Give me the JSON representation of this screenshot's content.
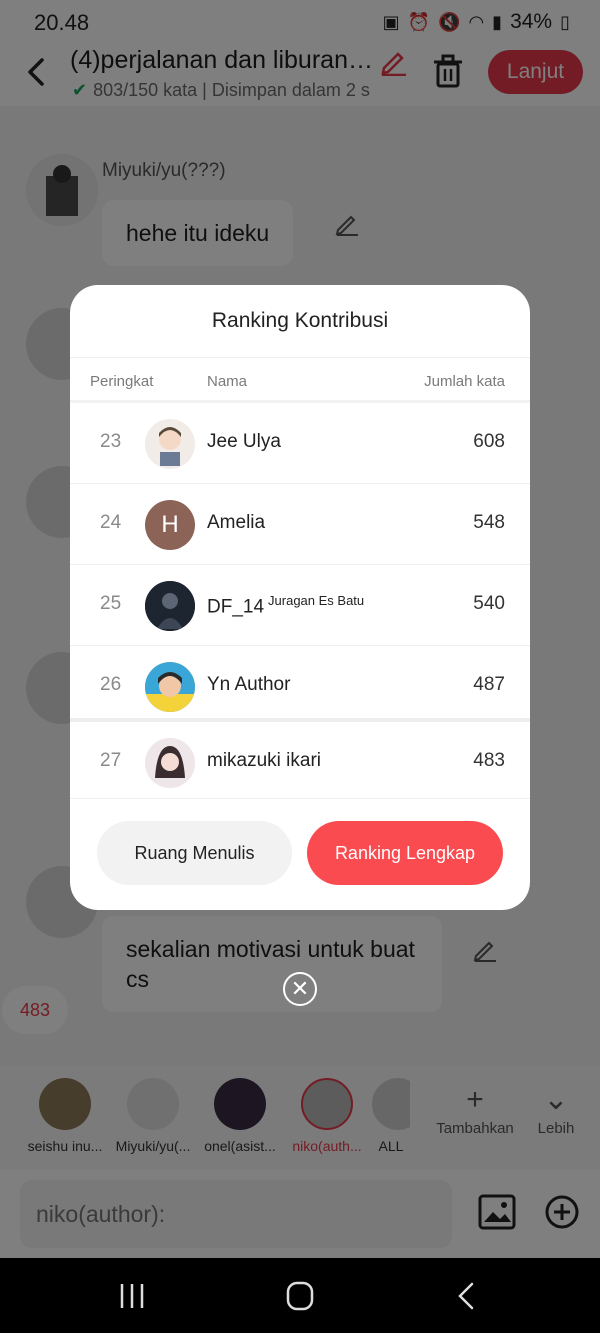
{
  "status_bar": {
    "time": "20.48",
    "battery": "34%"
  },
  "header": {
    "title": "(4)perjalanan dan liburan{...",
    "meta": "803/150 kata | Disimpan dalam 2 s",
    "next_label": "Lanjut"
  },
  "chat": {
    "messages": [
      {
        "author": "Miyuki/yu(???)",
        "text": "hehe itu ideku"
      },
      {
        "author": "",
        "text": "sekalian motivasi untuk buat cs"
      }
    ],
    "badge_count": "483"
  },
  "modal": {
    "title": "Ranking Kontribusi",
    "columns": {
      "rank": "Peringkat",
      "name": "Nama",
      "words": "Jumlah kata"
    },
    "rows": [
      {
        "rank": "23",
        "name": "Jee Ulya",
        "tag": "",
        "words": "608"
      },
      {
        "rank": "24",
        "name": "Amelia",
        "tag": "",
        "words": "548",
        "avatar_letter": "H"
      },
      {
        "rank": "25",
        "name": "DF_14",
        "tag": "Juragan Es Batu",
        "words": "540"
      },
      {
        "rank": "26",
        "name": "Yn Author",
        "tag": "",
        "words": "487"
      },
      {
        "rank": "27",
        "name": "mikazuki ikari",
        "tag": "",
        "words": "483"
      }
    ],
    "btn_room": "Ruang Menulis",
    "btn_full": "Ranking Lengkap"
  },
  "characters": [
    {
      "name": "seishu inu..."
    },
    {
      "name": "Miyuki/yu(..."
    },
    {
      "name": "onel(asist..."
    },
    {
      "name": "niko(auth..."
    },
    {
      "name": "ALL"
    }
  ],
  "bar_actions": {
    "add": "Tambahkan",
    "more": "Lebih"
  },
  "input": {
    "placeholder": "niko(author):"
  },
  "colors": {
    "accent": "#fa4b50",
    "amelia_avatar": "#8b6357"
  }
}
